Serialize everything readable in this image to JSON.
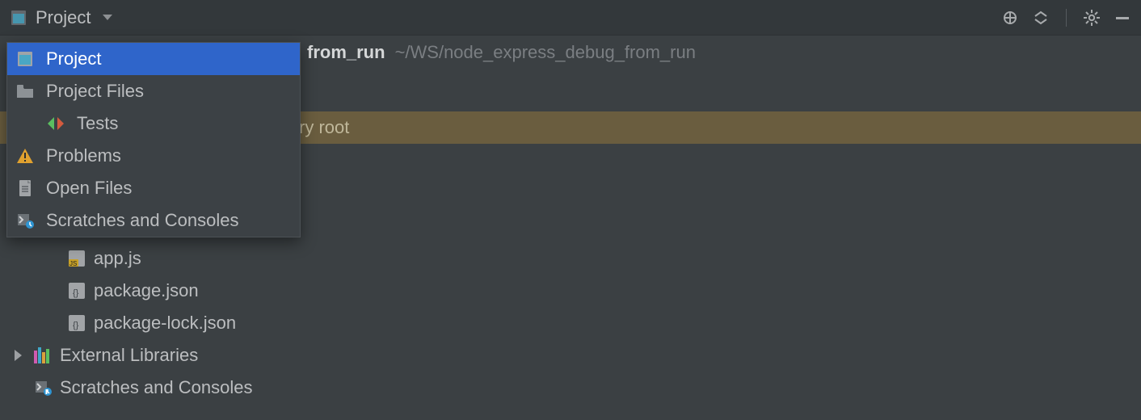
{
  "header": {
    "view_switch_label": "Project"
  },
  "project": {
    "name_suffix": "from_run",
    "path": "~/WS/node_express_debug_from_run"
  },
  "highlighted_row_text": "ry root",
  "dropdown": {
    "items": [
      {
        "label": "Project",
        "icon": "project-window-icon",
        "selected": true,
        "indent": 0
      },
      {
        "label": "Project Files",
        "icon": "folder-icon",
        "selected": false,
        "indent": 0
      },
      {
        "label": "Tests",
        "icon": "tests-icon",
        "selected": false,
        "indent": 1
      },
      {
        "label": "Problems",
        "icon": "problems-icon",
        "selected": false,
        "indent": 0
      },
      {
        "label": "Open Files",
        "icon": "open-files-icon",
        "selected": false,
        "indent": 0
      },
      {
        "label": "Scratches and Consoles",
        "icon": "scratches-icon",
        "selected": false,
        "indent": 0
      }
    ]
  },
  "tree": {
    "files": [
      {
        "label": "app.js",
        "icon": "js-file-icon"
      },
      {
        "label": "package.json",
        "icon": "json-file-icon"
      },
      {
        "label": "package-lock.json",
        "icon": "json-file-icon"
      }
    ],
    "external_libraries_label": "External Libraries",
    "scratches_label": "Scratches and Consoles"
  }
}
